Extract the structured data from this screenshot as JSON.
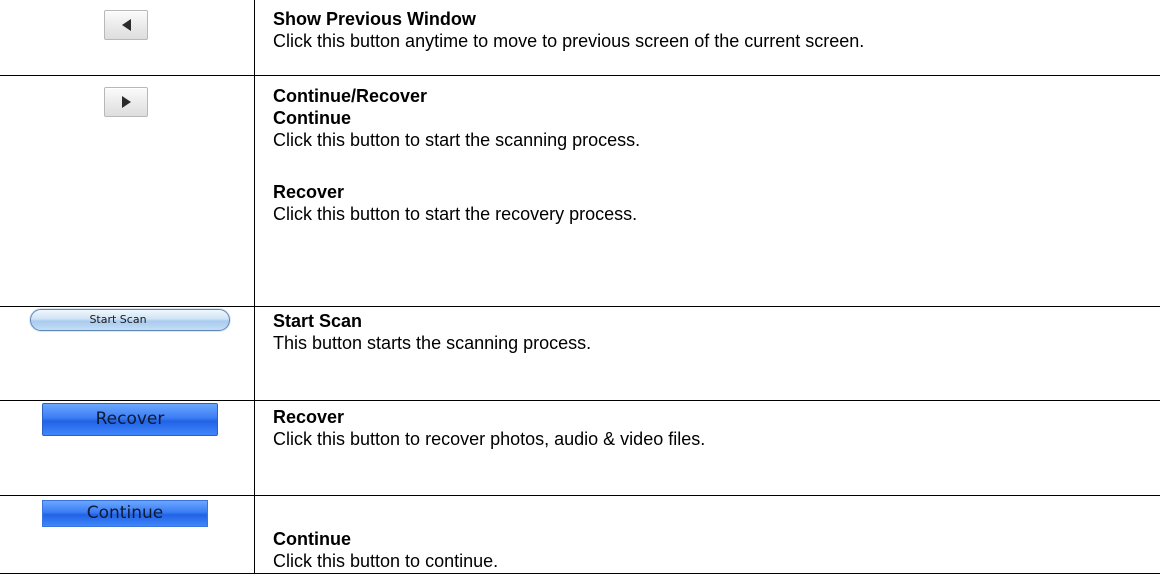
{
  "rows": [
    {
      "button": {
        "type": "arrow-left"
      },
      "title": "Show Previous Window",
      "description": "Click this button anytime to move to previous screen of the current screen."
    },
    {
      "button": {
        "type": "arrow-right"
      },
      "title": "Continue/Recover",
      "sub1_title": "Continue",
      "sub1_description": "Click this button to start the scanning process.",
      "sub2_title": "Recover",
      "sub2_description": "Click this button to start the recovery process."
    },
    {
      "button": {
        "type": "pill",
        "label": "Start Scan"
      },
      "title": "Start Scan",
      "description": "This button starts the scanning process."
    },
    {
      "button": {
        "type": "blue",
        "label": "Recover"
      },
      "title": "Recover",
      "description": "Click this button to recover photos, audio & video files."
    },
    {
      "button": {
        "type": "blue",
        "label": "Continue"
      },
      "title": "Continue",
      "description": "Click this button to continue."
    }
  ],
  "colors": {
    "text": "#000000",
    "border": "#000000",
    "button_blue": "#2f74f0",
    "pill_blue": "#b8d5f2"
  }
}
